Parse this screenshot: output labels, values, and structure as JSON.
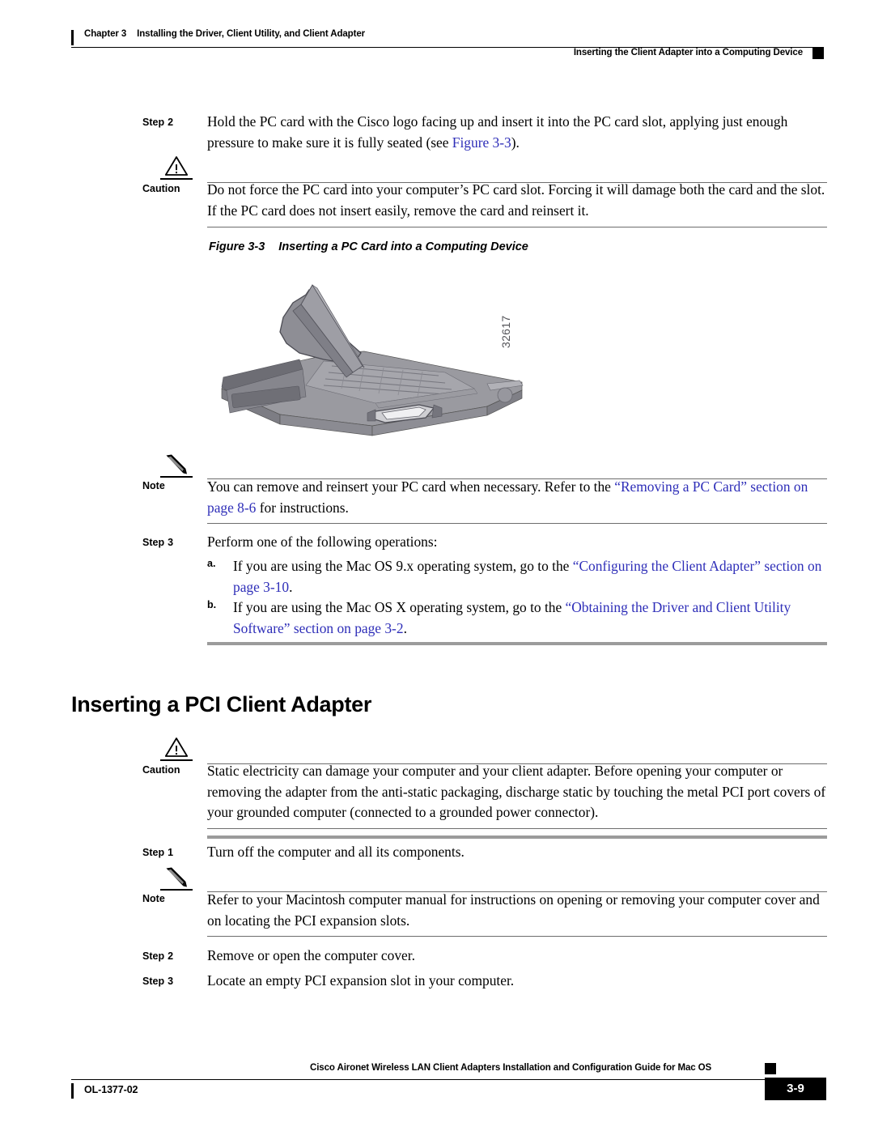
{
  "header": {
    "chapter_number": "Chapter 3",
    "chapter_title": "Installing the Driver, Client Utility, and Client Adapter",
    "section_title": "Inserting the Client Adapter into a Computing Device"
  },
  "content": {
    "step2_label": "Step",
    "step2_number": "2",
    "step2_text_a": "Hold the PC card with the Cisco logo facing up and insert it into the PC card slot, applying just enough pressure to make sure it is fully seated (see ",
    "step2_xref": "Figure 3-3",
    "step2_text_b": ").",
    "caution1_label": "Caution",
    "caution1_text": "Do not force the PC card into your computer’s PC card slot. Forcing it will damage both the card and the slot. If the PC card does not insert easily, remove the card and reinsert it.",
    "figure_number": "Figure 3-3",
    "figure_title": "Inserting a PC Card into a Computing Device",
    "figure_id": "32617",
    "note1_label": "Note",
    "note1_text_a": "You can remove and reinsert your PC card when necessary. Refer to the ",
    "note1_xref": "“Removing a PC Card” section on page 8-6",
    "note1_text_b": " for instructions.",
    "step3_label": "Step",
    "step3_number": "3",
    "step3_text": "Perform one of the following operations:",
    "substep_a_marker": "a.",
    "substep_a_text_a": "If you are using the Mac OS 9.x operating system, go to the ",
    "substep_a_xref": "“Configuring the Client Adapter” section on page 3-10",
    "substep_a_text_b": ".",
    "substep_b_marker": "b.",
    "substep_b_text_a": "If you are using the Mac OS X operating system, go to the ",
    "substep_b_xref": "“Obtaining the Driver and Client Utility Software” section on page 3-2",
    "substep_b_text_b": ".",
    "heading": "Inserting a PCI Client Adapter",
    "caution2_label": "Caution",
    "caution2_text": "Static electricity can damage your computer and your client adapter. Before opening your computer or removing the adapter from the anti-static packaging, discharge static by touching the metal PCI port covers of your grounded computer (connected to a grounded power connector).",
    "pci_step1_label": "Step",
    "pci_step1_number": "1",
    "pci_step1_text": "Turn off the computer and all its components.",
    "note2_label": "Note",
    "note2_text": "Refer to your Macintosh computer manual for instructions on opening or removing your computer cover and on locating the PCI expansion slots.",
    "pci_step2_label": "Step",
    "pci_step2_number": "2",
    "pci_step2_text": "Remove or open the computer cover.",
    "pci_step3_label": "Step",
    "pci_step3_number": "3",
    "pci_step3_text": "Locate an empty PCI expansion slot in your computer."
  },
  "footer": {
    "guide_title": "Cisco Aironet Wireless LAN Client Adapters Installation and Configuration Guide for Mac OS",
    "doc_id": "OL-1377-02",
    "page_number": "3-9"
  },
  "colors": {
    "xref_link": "#2e2eb8",
    "rule_gray": "#6d6d6d",
    "thick_rule_gray": "#9b9b9b",
    "figure_body": "#8d8d93",
    "figure_light": "#a9a9af",
    "figure_dark": "#6b6b72"
  }
}
